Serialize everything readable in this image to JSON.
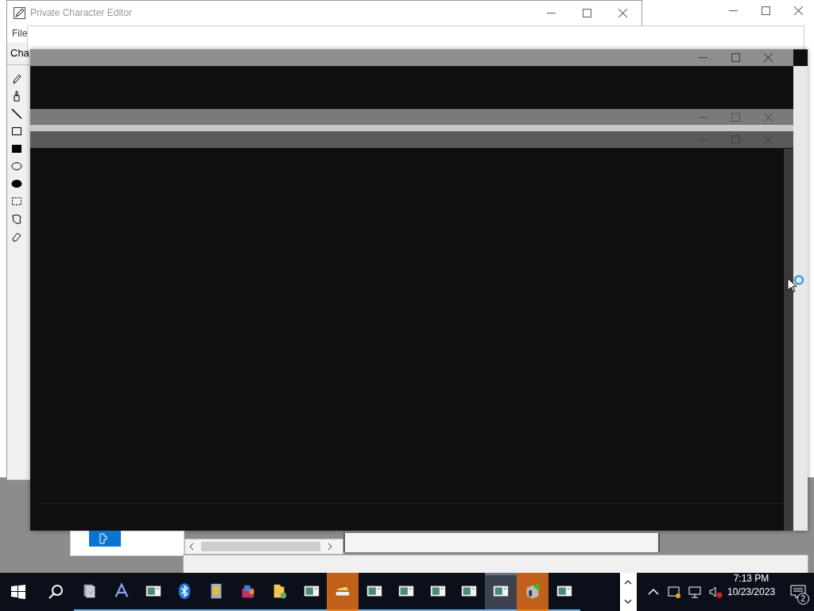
{
  "editor_window": {
    "title": "Private Character Editor",
    "menu": [
      "File"
    ],
    "panel_label": "Cha"
  },
  "taskbar": {
    "items": [
      {
        "kind": "docs",
        "flashing": false,
        "selected": false
      },
      {
        "kind": "font",
        "flashing": false,
        "selected": false
      },
      {
        "kind": "window",
        "flashing": false,
        "selected": false
      },
      {
        "kind": "bluetooth",
        "flashing": false,
        "selected": false
      },
      {
        "kind": "book",
        "flashing": false,
        "selected": false
      },
      {
        "kind": "archive",
        "flashing": false,
        "selected": false
      },
      {
        "kind": "folder",
        "flashing": false,
        "selected": false
      },
      {
        "kind": "window",
        "flashing": false,
        "selected": false
      },
      {
        "kind": "scanner",
        "flashing": true,
        "selected": false
      },
      {
        "kind": "window",
        "flashing": false,
        "selected": false
      },
      {
        "kind": "window",
        "flashing": false,
        "selected": false
      },
      {
        "kind": "window",
        "flashing": false,
        "selected": false
      },
      {
        "kind": "window",
        "flashing": false,
        "selected": false
      },
      {
        "kind": "window",
        "flashing": false,
        "selected": true
      },
      {
        "kind": "package",
        "flashing": true,
        "selected": false
      },
      {
        "kind": "window",
        "flashing": false,
        "selected": false
      }
    ],
    "time": "7:13 PM",
    "date": "10/23/2023",
    "notification_count": "2"
  }
}
